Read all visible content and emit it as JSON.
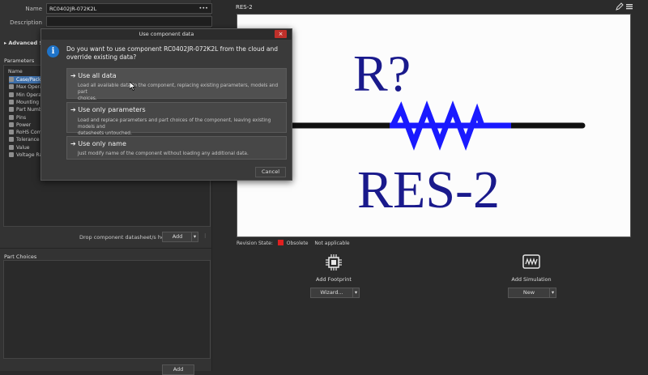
{
  "left": {
    "name_label": "Name",
    "name_value": "RC0402JR-072K2L",
    "name_more": "•••",
    "description_label": "Description",
    "advanced_label": "Advanced Settings",
    "parameters_header": "Parameters",
    "params_col_name": "Name",
    "params": [
      "Case/Package",
      "Max Operating Temperature",
      "Min Operating Temperature",
      "Mounting Type",
      "Part Number",
      "Pins",
      "Power",
      "RoHS Compliant",
      "Tolerance",
      "Value",
      "Voltage Rating"
    ],
    "drop_text": "Drop component datasheet/s here or",
    "add_label": "Add",
    "part_choices_header": "Part Choices",
    "bottom_add_label": "Add"
  },
  "preview": {
    "title": "RES-2",
    "designator": "R?",
    "comment": "RES-2",
    "revision_label": "Revision State:",
    "revision_state": "Obsolete",
    "revision_detail": "Not applicable"
  },
  "actions": {
    "footprint_label": "Add Footprint",
    "footprint_button": "Wizard...",
    "simulation_label": "Add Simulation",
    "simulation_button": "New"
  },
  "dialog": {
    "title": "Use component data",
    "question_line1": "Do you want to use component RC0402JR-072K2L from the cloud and",
    "question_line2": "override existing data?",
    "options": [
      {
        "title": "Use all data",
        "desc1": "Load all available data to the component, replacing existing parameters, models and part",
        "desc2": "choices."
      },
      {
        "title": "Use only parameters",
        "desc1": "Load and replace parameters and part choices of the component, leaving existing models and",
        "desc2": "datasheets untouched."
      },
      {
        "title": "Use only name",
        "desc1": "Just modify name of the component without loading any additional data.",
        "desc2": ""
      }
    ],
    "cancel_label": "Cancel",
    "close_glyph": "×",
    "arrow_glyph": "➔",
    "info_glyph": "i"
  },
  "colors": {
    "resistor_blue": "#1a1aff",
    "text_navy": "#1a1a8c",
    "obsolete_red": "#e02020",
    "info_blue": "#1e73c8"
  }
}
